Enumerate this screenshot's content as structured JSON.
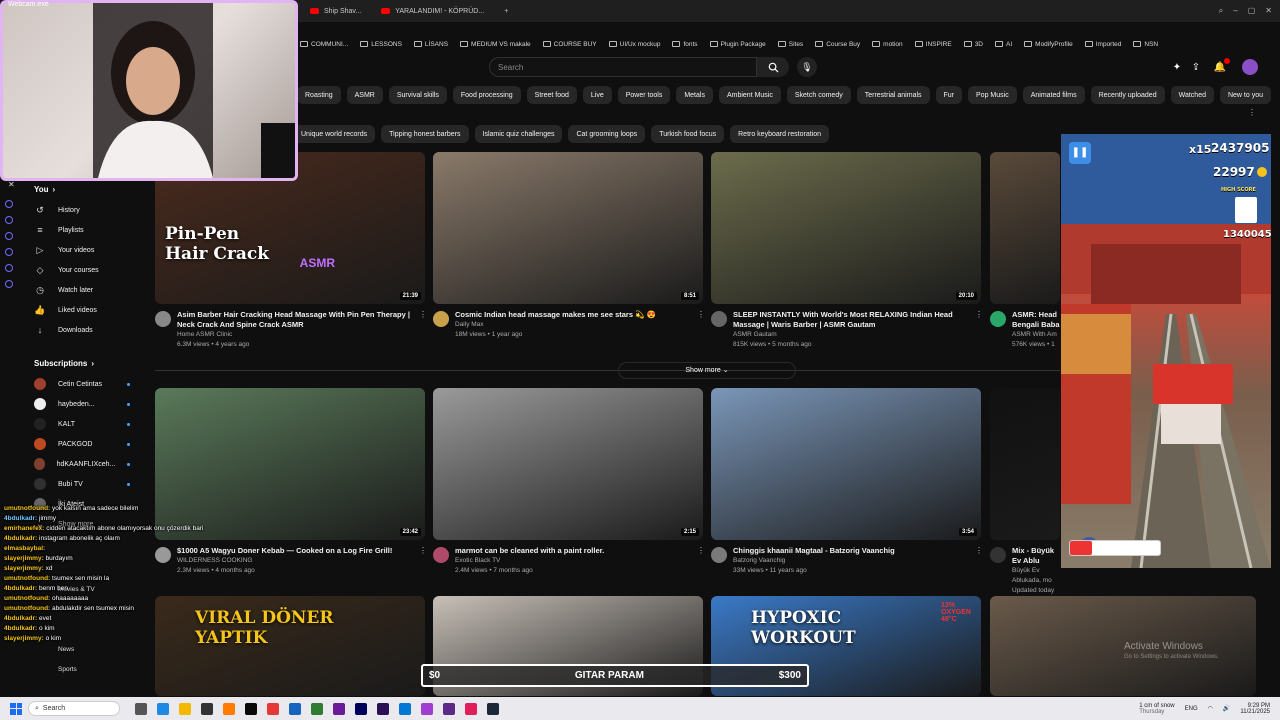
{
  "webcam": {
    "label": "Webcam.exe"
  },
  "tabs": [
    {
      "label": "Ship Shav..."
    },
    {
      "label": "YARALANDIM! - KÖPRÜD..."
    }
  ],
  "bookmarks": [
    "COMMUNI...",
    "LESSONS",
    "LİSANS",
    "MEDIUM VS makale",
    "COURSE BUY",
    "UI/Ux mockup",
    "fonts",
    "Plugin Package",
    "Sites",
    "Course Buy",
    "motion",
    "INSPIRE",
    "3D",
    "AI",
    "ModifyProfile",
    "Imported",
    "NSN"
  ],
  "search": {
    "placeholder": "Search"
  },
  "chips_row1": [
    "Roasting",
    "ASMR",
    "Survival skills",
    "Food processing",
    "Street food",
    "Live",
    "Power tools",
    "Metals",
    "Ambient Music",
    "Sketch comedy",
    "Terrestrial animals",
    "Fur",
    "Pop Music",
    "Animated films",
    "Recently uploaded",
    "Watched",
    "New to you"
  ],
  "chips_row2": [
    "Unique world records",
    "Tipping honest barbers",
    "Islamic quiz challenges",
    "Cat grooming loops",
    "Turkish food focus",
    "Retro keyboard restoration"
  ],
  "sidebar": {
    "you": "You",
    "items": [
      {
        "label": "History",
        "icon": "history-icon"
      },
      {
        "label": "Playlists",
        "icon": "playlists-icon"
      },
      {
        "label": "Your videos",
        "icon": "your-videos-icon"
      },
      {
        "label": "Your courses",
        "icon": "courses-icon"
      },
      {
        "label": "Watch later",
        "icon": "watch-later-icon"
      },
      {
        "label": "Liked videos",
        "icon": "like-icon"
      },
      {
        "label": "Downloads",
        "icon": "download-icon"
      }
    ],
    "subscriptions": "Subscriptions",
    "subs": [
      {
        "label": "Cetin Cetintas",
        "color": "#a04030"
      },
      {
        "label": "haybeden...",
        "color": "#eeeeee"
      },
      {
        "label": "KALT",
        "color": "#222222"
      },
      {
        "label": "PACKGOD",
        "color": "#c04a20"
      },
      {
        "label": "hdKAANFLIXceh...",
        "color": "#804030"
      },
      {
        "label": "Bubi TV",
        "color": "#303030"
      },
      {
        "label": "İki Ateist",
        "color": "#666666"
      }
    ],
    "show_more": "Show more",
    "movies": "Movies & TV",
    "news": "News",
    "sports": "Sports"
  },
  "videos": [
    {
      "title": "Asim Barber Hair Cracking Head Massage With Pin Pen Therapy | Neck Crack And Spine Crack ASMR",
      "channel": "Home ASMR Clinic",
      "stats": "6.3M views • 4 years ago",
      "duration": "21:39",
      "thumb_text": "Pin-Pen\nHair Crack",
      "thumb_badge": "ASMR",
      "thumb_color": "#4a2a1c"
    },
    {
      "title": "Cosmic Indian head massage makes me see stars 💫 😍",
      "channel": "Daily Max",
      "stats": "18M views • 1 year ago",
      "duration": "8:51",
      "thumb_color": "#8a7a6a"
    },
    {
      "title": "SLEEP INSTANTLY With World's Most RELAXING Indian Head Massage | Waris Barber | ASMR Gautam",
      "channel": "ASMR Gautam",
      "stats": "815K views • 5 months ago",
      "duration": "20:10",
      "thumb_color": "#6c6c4c"
    },
    {
      "title": "ASMR: Head Bengali Baba",
      "channel": "ASMR With Am",
      "stats": "576K views • 1",
      "thumb_color": "#5a4a3a"
    },
    {
      "title": "$1000 A5 Wagyu Doner Kebab — Cooked on a Log Fire Grill!",
      "channel": "WILDERNESS COOKING",
      "stats": "2.3M views • 4 months ago",
      "duration": "23:42",
      "thumb_color": "#5a7a5a"
    },
    {
      "title": "marmot can be cleaned with a paint roller.",
      "channel": "Exotic Black TV",
      "stats": "2.4M views • 7 months ago",
      "duration": "2:15",
      "thumb_color": "#9a9a9a"
    },
    {
      "title": "Chinggis khaanii Magtaal - Batzorig Vaanchig",
      "channel": "Batzorig Vaanchig",
      "stats": "33M views • 11 years ago",
      "duration": "3:54",
      "thumb_color": "#7a96b8"
    },
    {
      "title": "Mix - Büyük Ev Ablu",
      "channel": "Büyük Ev Ablukada, mo",
      "stats": "Updated today",
      "thumb_color": "#111111"
    },
    {
      "thumb_text": "VIRAL DÖNER\nYAPTIK",
      "thumb_color": "#3a2a1a"
    },
    {
      "thumb_color": "#c8c0b8"
    },
    {
      "thumb_text": "HYPOXIC\nWORKOUT",
      "thumb_badge": "13% OXYGEN 48°C",
      "thumb_color": "#3a7ac8"
    },
    {
      "thumb_color": "#6a5a4a"
    }
  ],
  "show_more_btn": "Show more",
  "game": {
    "score": "2437905",
    "coins": "22997",
    "multiplier": "x15",
    "high_score_label": "HIGH SCORE",
    "high_score": "1340045"
  },
  "chat": [
    {
      "user": "umutnotfound:",
      "text": "yok kalsın ama sadece bilelim"
    },
    {
      "user": "4bdulkadr:",
      "text": "jimmy",
      "blue": true
    },
    {
      "user": "emirhanefex:",
      "text": "cidden atacaktım abone olamıyorsak onu çözerdik bari"
    },
    {
      "user": "4bdulkadr:",
      "text": "instagram abonelik aç olaım"
    },
    {
      "user": "elmasbaybal:",
      "text": ""
    },
    {
      "user": "slayerjimmy:",
      "text": "burdayım"
    },
    {
      "user": "slayerjimmy:",
      "text": "xd"
    },
    {
      "user": "umutnotfound:",
      "text": "tsumex sen misin la"
    },
    {
      "user": "4bdulkadr:",
      "text": "benm ben"
    },
    {
      "user": "umutnotfound:",
      "text": "ohaaaaaaaa"
    },
    {
      "user": "umutnotfound:",
      "text": "abdulakdir sen tsumex misin"
    },
    {
      "user": "4bdulkadr:",
      "text": "evet"
    },
    {
      "user": "4bdulkadr:",
      "text": "o kim"
    },
    {
      "user": "slayerjimmy:",
      "text": "o kim"
    }
  ],
  "donation": {
    "left": "$0",
    "label": "GITAR PARAM",
    "right": "$300"
  },
  "taskbar": {
    "search": "Search",
    "weather": "1 cm of snow",
    "weather_sub": "Thursday",
    "lang": "ENG",
    "time": "9:29 PM",
    "date": "11/21/2025",
    "watermark": "Activate Windows",
    "watermark_sub": "Go to Settings to activate Windows."
  }
}
